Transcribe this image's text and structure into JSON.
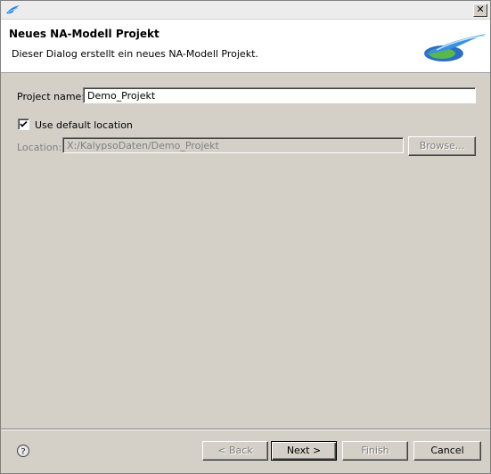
{
  "titlebar": {
    "close_label": "✕"
  },
  "header": {
    "title": "Neues NA-Modell Projekt",
    "description": "Dieser Dialog erstellt ein neues NA-Modell Projekt."
  },
  "form": {
    "project_name_label": "Project name:",
    "project_name_value": "Demo_Projekt",
    "use_default_location_label": "Use default location",
    "use_default_location_checked": true,
    "location_label": "Location:",
    "location_value": "X:/KalypsoDaten/Demo_Projekt",
    "browse_label": "Browse..."
  },
  "buttons": {
    "back_label": "< Back",
    "next_label": "Next >",
    "finish_label": "Finish",
    "cancel_label": "Cancel"
  },
  "icons": {
    "app": "app-logo-icon",
    "close": "close-icon",
    "help": "help-icon",
    "banner": "wizard-banner-logo"
  },
  "colors": {
    "dialog_bg": "#d4d0c8",
    "header_bg": "#ffffff",
    "logo_blue": "#1f6fc0",
    "logo_green": "#5cb84a"
  }
}
